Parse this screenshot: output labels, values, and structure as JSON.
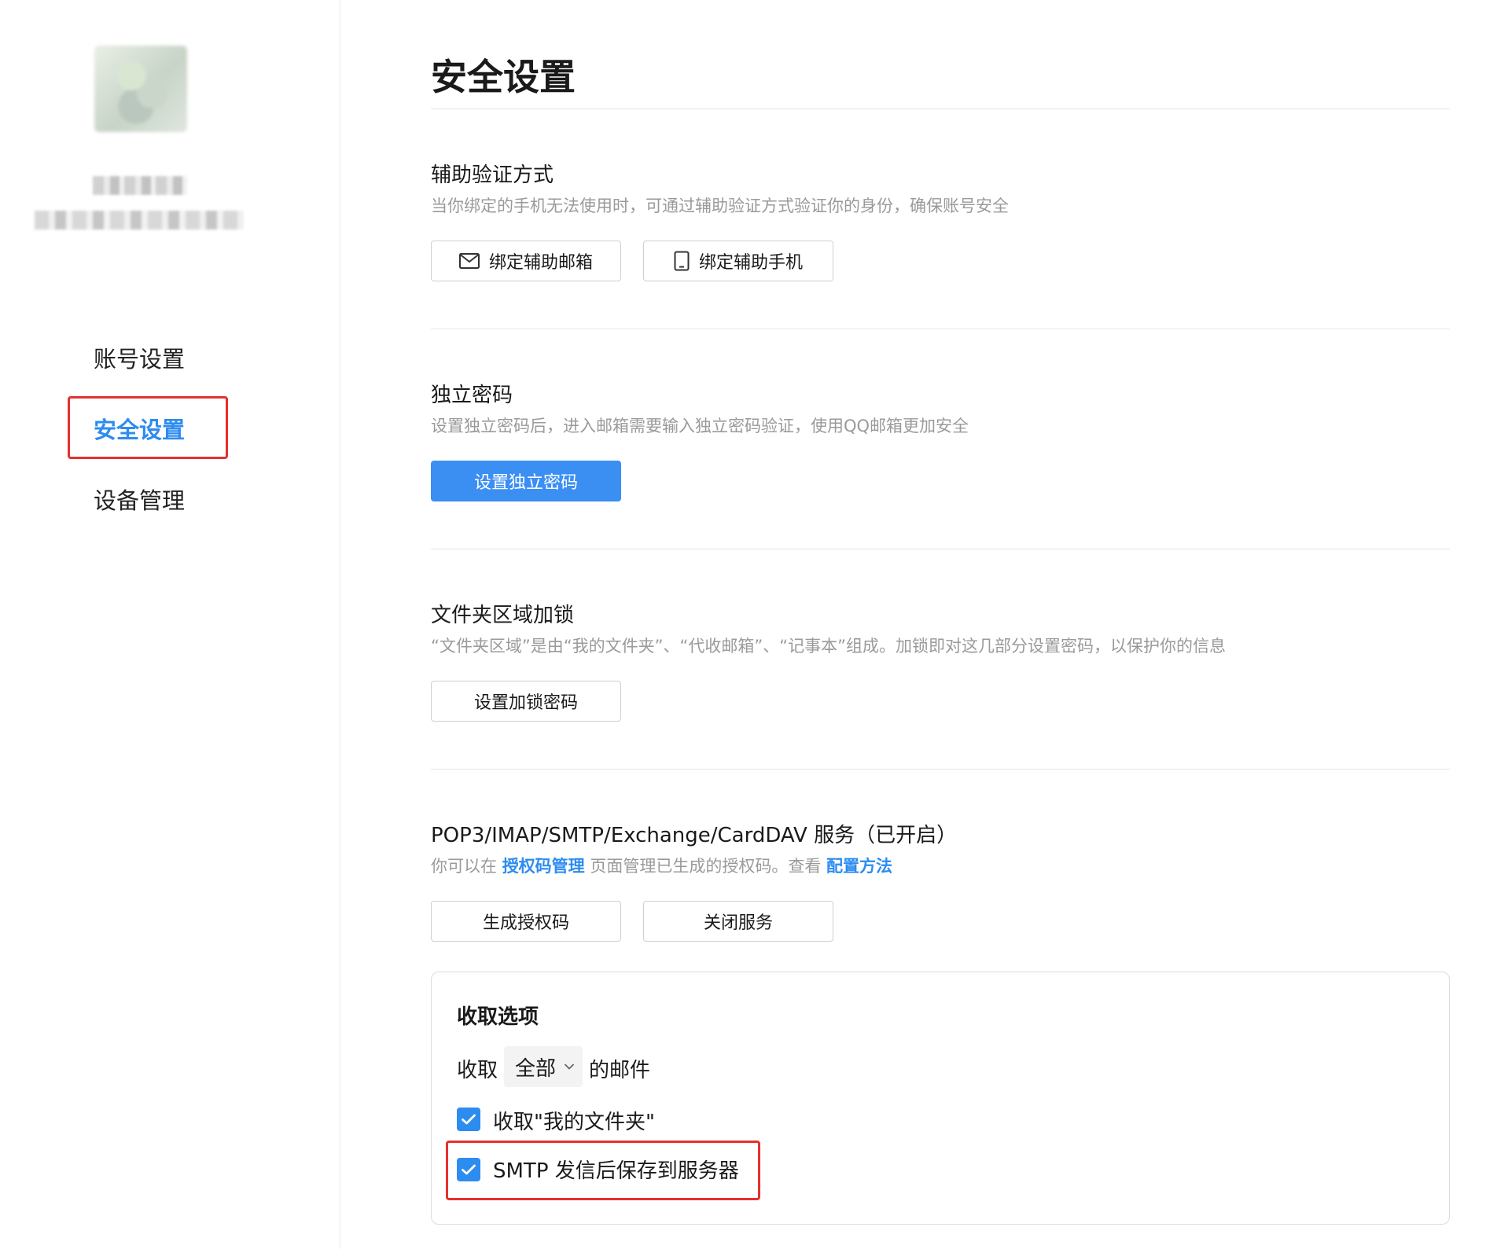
{
  "sidebar": {
    "nav": [
      {
        "label": "账号设置"
      },
      {
        "label": "安全设置"
      },
      {
        "label": "设备管理"
      }
    ]
  },
  "main": {
    "title": "安全设置",
    "sections": {
      "aux": {
        "title": "辅助验证方式",
        "desc": "当你绑定的手机无法使用时，可通过辅助验证方式验证你的身份，确保账号安全",
        "btn_email": "绑定辅助邮箱",
        "btn_phone": "绑定辅助手机"
      },
      "password": {
        "title": "独立密码",
        "desc": "设置独立密码后，进入邮箱需要输入独立密码验证，使用QQ邮箱更加安全",
        "btn": "设置独立密码"
      },
      "folderlock": {
        "title": "文件夹区域加锁",
        "desc": "“文件夹区域”是由“我的文件夹”、“代收邮箱”、“记事本”组成。加锁即对这几部分设置密码，以保护你的信息",
        "btn": "设置加锁密码"
      },
      "services": {
        "title": "POP3/IMAP/SMTP/Exchange/CardDAV 服务（已开启）",
        "desc_prefix": "你可以在 ",
        "link1": "授权码管理",
        "desc_middle": " 页面管理已生成的授权码。查看 ",
        "link2": "配置方法",
        "btn_generate": "生成授权码",
        "btn_close": "关闭服务"
      }
    },
    "receive": {
      "title": "收取选项",
      "prefix": "收取",
      "select_value": "全部",
      "suffix": "的邮件",
      "opt1": "收取\"我的文件夹\"",
      "opt2": "SMTP 发信后保存到服务器"
    }
  },
  "colors": {
    "accent": "#2d8cf0",
    "highlight": "#e5302f"
  }
}
